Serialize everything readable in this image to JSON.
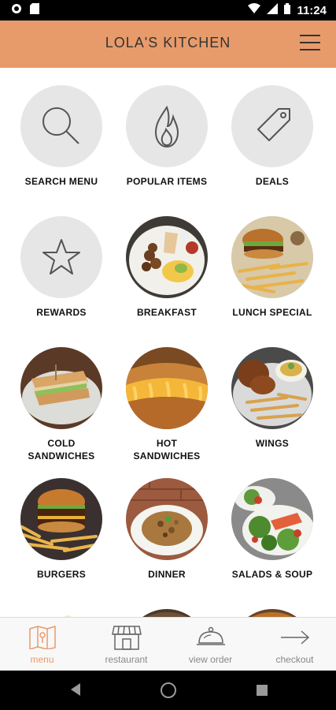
{
  "status": {
    "time": "11:24"
  },
  "header": {
    "title": "LOLA'S KITCHEN"
  },
  "tiles": [
    {
      "label": "SEARCH MENU",
      "icon": "search-icon"
    },
    {
      "label": "POPULAR ITEMS",
      "icon": "flame-icon"
    },
    {
      "label": "DEALS",
      "icon": "tag-icon"
    },
    {
      "label": "REWARDS",
      "icon": "star-icon"
    },
    {
      "label": "BREAKFAST",
      "icon": "breakfast-photo"
    },
    {
      "label": "LUNCH SPECIAL",
      "icon": "lunch-special-photo"
    },
    {
      "label": "COLD SANDWICHES",
      "icon": "cold-sandwiches-photo"
    },
    {
      "label": "HOT SANDWICHES",
      "icon": "hot-sandwiches-photo"
    },
    {
      "label": "WINGS",
      "icon": "wings-photo"
    },
    {
      "label": "BURGERS",
      "icon": "burgers-photo"
    },
    {
      "label": "DINNER",
      "icon": "dinner-photo"
    },
    {
      "label": "SALADS & SOUP",
      "icon": "salads-soup-photo"
    }
  ],
  "bottom_nav": [
    {
      "label": "menu",
      "icon": "menu-book-icon",
      "active": true
    },
    {
      "label": "restaurant",
      "icon": "storefront-icon",
      "active": false
    },
    {
      "label": "view order",
      "icon": "cloche-icon",
      "active": false
    },
    {
      "label": "checkout",
      "icon": "arrow-right-icon",
      "active": false
    }
  ],
  "colors": {
    "accent": "#e89b6a",
    "header_text": "#333333",
    "tile_bg": "#e6e6e6"
  }
}
